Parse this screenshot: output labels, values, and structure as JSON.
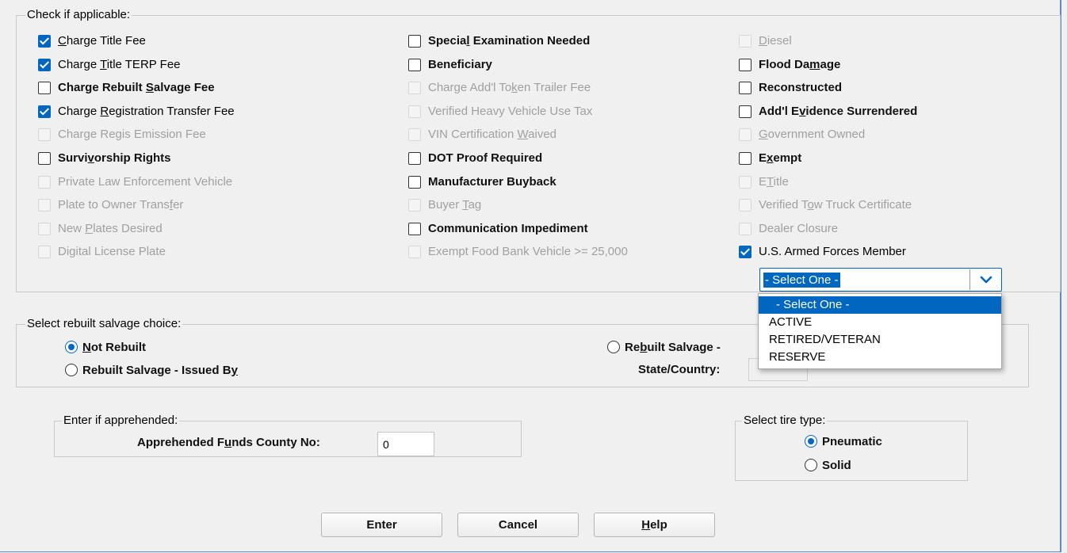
{
  "applicable": {
    "legend": "Check if applicable:",
    "col1": [
      {
        "pre": "",
        "acc": "C",
        "post": "harge Title Fee",
        "state": "checked"
      },
      {
        "pre": "Charge ",
        "acc": "T",
        "post": "itle TERP Fee",
        "state": "checked"
      },
      {
        "pre": "Charge Rebuilt ",
        "acc": "S",
        "post": "alvage Fee",
        "state": "enabled"
      },
      {
        "pre": "Charge ",
        "acc": "R",
        "post": "egistration Transfer Fee",
        "state": "checked"
      },
      {
        "pre": "Char",
        "acc": "g",
        "post": "e Regis Emission Fee",
        "state": "disabled"
      },
      {
        "pre": "Survi",
        "acc": "v",
        "post": "orship Rights",
        "state": "enabled"
      },
      {
        "pre": "Private Law Enforcement Vehicle",
        "acc": "",
        "post": "",
        "state": "disabled"
      },
      {
        "pre": "Plate to Owner Trans",
        "acc": "f",
        "post": "er",
        "state": "disabled"
      },
      {
        "pre": "New ",
        "acc": "P",
        "post": "lates Desired",
        "state": "disabled"
      },
      {
        "pre": "Digital License Plate",
        "acc": "",
        "post": "",
        "state": "disabled"
      }
    ],
    "col2": [
      {
        "pre": "Specia",
        "acc": "l",
        "post": " Examination Needed",
        "state": "enabled"
      },
      {
        "pre": "Beneficiary",
        "acc": "",
        "post": "",
        "state": "enabled"
      },
      {
        "pre": "Charge Add'l To",
        "acc": "k",
        "post": "en Trailer Fee",
        "state": "disabled"
      },
      {
        "pre": "Verified Heavy Vehicle Use Tax",
        "acc": "",
        "post": "",
        "state": "disabled"
      },
      {
        "pre": "VIN Certification ",
        "acc": "W",
        "post": "aived",
        "state": "disabled"
      },
      {
        "pre": "DOT Proof Required",
        "acc": "",
        "post": "",
        "state": "enabled"
      },
      {
        "pre": "Manufacturer Buyback",
        "acc": "",
        "post": "",
        "state": "enabled"
      },
      {
        "pre": "Buyer ",
        "acc": "T",
        "post": "ag",
        "state": "disabled"
      },
      {
        "pre": "Communication Impediment",
        "acc": "",
        "post": "",
        "state": "enabled"
      },
      {
        "pre": "Exempt Food Bank Vehicle >= 25,000",
        "acc": "",
        "post": "",
        "state": "disabled"
      }
    ],
    "col3": [
      {
        "pre": "",
        "acc": "D",
        "post": "iesel",
        "state": "disabled"
      },
      {
        "pre": "Flood Da",
        "acc": "m",
        "post": "age",
        "state": "enabled"
      },
      {
        "pre": "Reconstructed",
        "acc": "",
        "post": "",
        "state": "enabled"
      },
      {
        "pre": "Add'l E",
        "acc": "v",
        "post": "idence Surrendered",
        "state": "enabled"
      },
      {
        "pre": "",
        "acc": "G",
        "post": "overnment Owned",
        "state": "disabled"
      },
      {
        "pre": "E",
        "acc": "x",
        "post": "empt",
        "state": "enabled"
      },
      {
        "pre": "E",
        "acc": "T",
        "post": "itle",
        "state": "disabled"
      },
      {
        "pre": "Verified T",
        "acc": "o",
        "post": "w Truck Certificate",
        "state": "disabled"
      },
      {
        "pre": "Dealer Closure",
        "acc": "",
        "post": "",
        "state": "disabled"
      },
      {
        "pre": "U.S. Armed Forces Member",
        "acc": "",
        "post": "",
        "state": "checked"
      }
    ],
    "armed_select": {
      "value": "- Select One -",
      "options": [
        "- Select One -",
        "ACTIVE",
        "RETIRED/VETERAN",
        "RESERVE"
      ]
    }
  },
  "salvage": {
    "legend": "Select rebuilt salvage choice:",
    "opt_not_rebuilt": {
      "pre": "",
      "acc": "N",
      "post": "ot Rebuilt"
    },
    "opt_issued_by": {
      "pre": "Rebuilt Salvage - Issued B",
      "acc": "y",
      "post": ""
    },
    "opt_rebuilt_right": {
      "pre": "Re",
      "acc": "b",
      "post": "uilt Salvage -"
    },
    "state_label": "State/Country:",
    "state_value": ""
  },
  "apprehended": {
    "legend": "Enter if apprehended:",
    "label": {
      "pre": "Apprehended F",
      "acc": "u",
      "post": "nds County No:"
    },
    "value": "0"
  },
  "tire": {
    "legend": "Select tire type:",
    "pneumatic": "Pneumatic",
    "solid": "Solid"
  },
  "buttons": {
    "enter": "Enter",
    "cancel": "Cancel",
    "help": {
      "pre": "",
      "acc": "H",
      "post": "elp"
    }
  },
  "colors": {
    "accent": "#0067c0",
    "frame": "#5a8bd1",
    "disabled_text": "#a0a0a0"
  }
}
